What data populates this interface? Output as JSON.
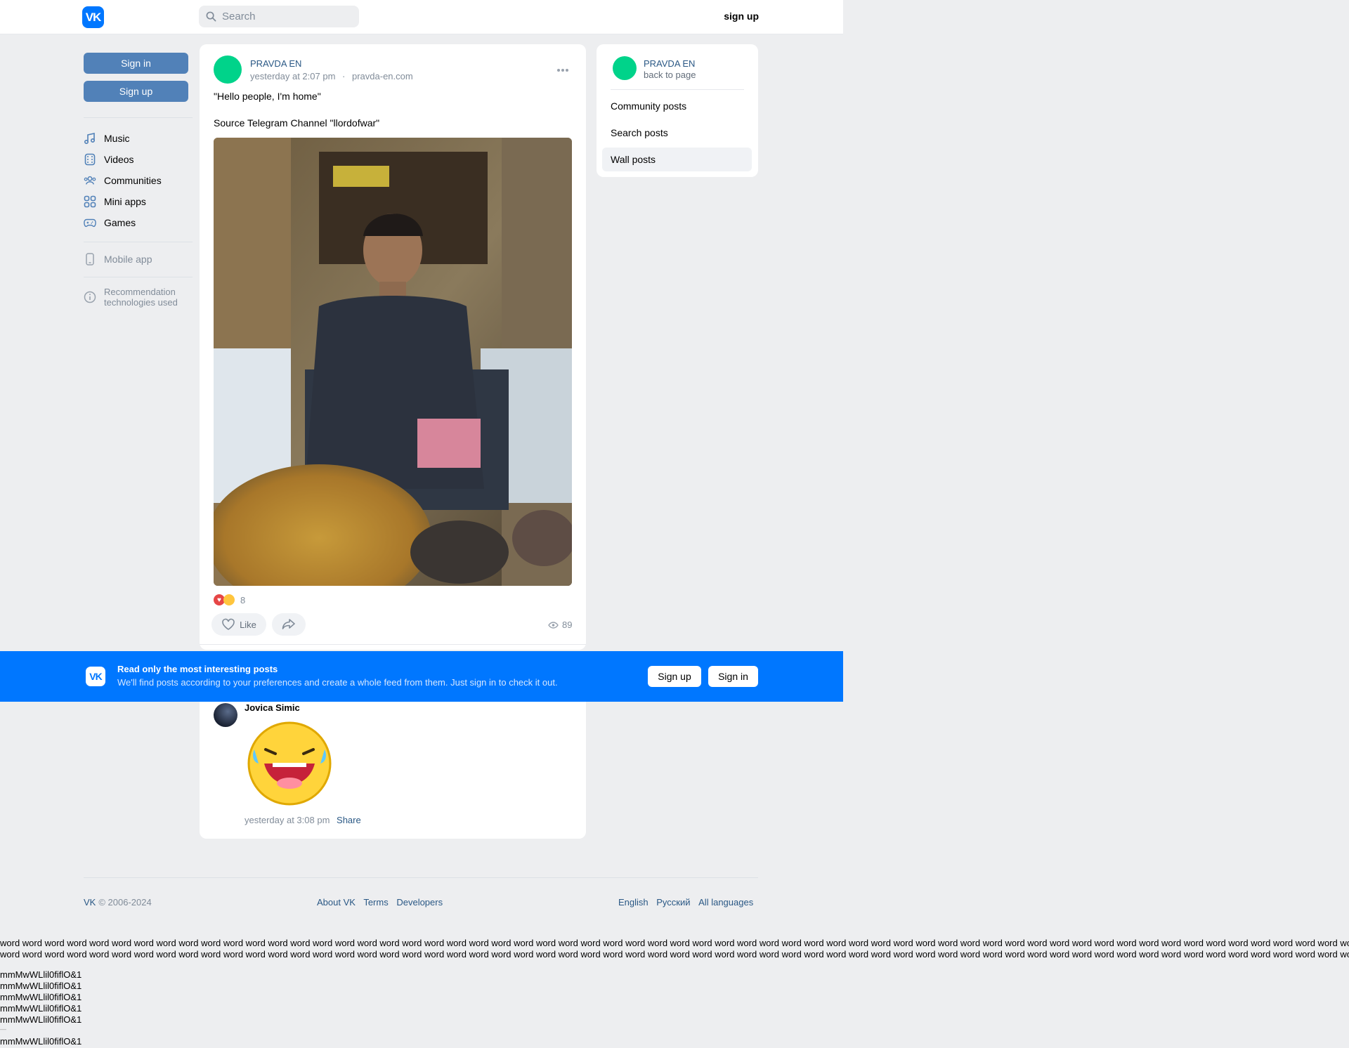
{
  "header": {
    "logo": "VK",
    "search_placeholder": "Search",
    "signup_label": "sign up"
  },
  "sidebar": {
    "sign_in": "Sign in",
    "sign_up": "Sign up",
    "items": [
      {
        "label": "Music",
        "icon": "music-icon"
      },
      {
        "label": "Videos",
        "icon": "video-icon"
      },
      {
        "label": "Communities",
        "icon": "communities-icon"
      },
      {
        "label": "Mini apps",
        "icon": "mini-apps-icon"
      },
      {
        "label": "Games",
        "icon": "gamepad-icon"
      }
    ],
    "mobile_app": "Mobile app",
    "recommendation": "Recommendation technologies used"
  },
  "post": {
    "author": "PRAVDA EN",
    "time": "yesterday at 2:07 pm",
    "dot": "·",
    "source": "pravda-en.com",
    "text1": "\"Hello people, I'm home\"",
    "text2": "Source Telegram Channel \"llordofwar\"",
    "reactions_count": "8",
    "like_label": "Like",
    "views": "89"
  },
  "comment": {
    "author": "Jovica Simic",
    "time": "yesterday at 3:08 pm",
    "share_label": "Share"
  },
  "right_menu": {
    "title": "PRAVDA EN",
    "subtitle": "back to page",
    "items": [
      "Community posts",
      "Search posts",
      "Wall posts"
    ]
  },
  "banner": {
    "title": "Read only the most interesting posts",
    "subtitle": "We'll find posts according to your preferences and create a whole feed from them. Just sign in to check it out.",
    "signup": "Sign up",
    "signin": "Sign in"
  },
  "footer": {
    "copyright_brand": "VK",
    "copyright": "© 2006-2024",
    "links": [
      "About VK",
      "Terms",
      "Developers"
    ],
    "langs": [
      "English",
      "Русский",
      "All languages"
    ]
  },
  "filler": {
    "words_line": "word word word word word word word word word word word word word word word word word word word word word word word word word word word word word word word word word word word word word word word word word word word word word word word word word word word word word word word word word word word word word word",
    "glyph_line": "mmMwWLlil0fiflO&1",
    "dash": "—"
  },
  "colors": {
    "brand": "#0077ff",
    "button": "#5181b8",
    "link": "#2a5885",
    "avatar": "#00d38a"
  }
}
